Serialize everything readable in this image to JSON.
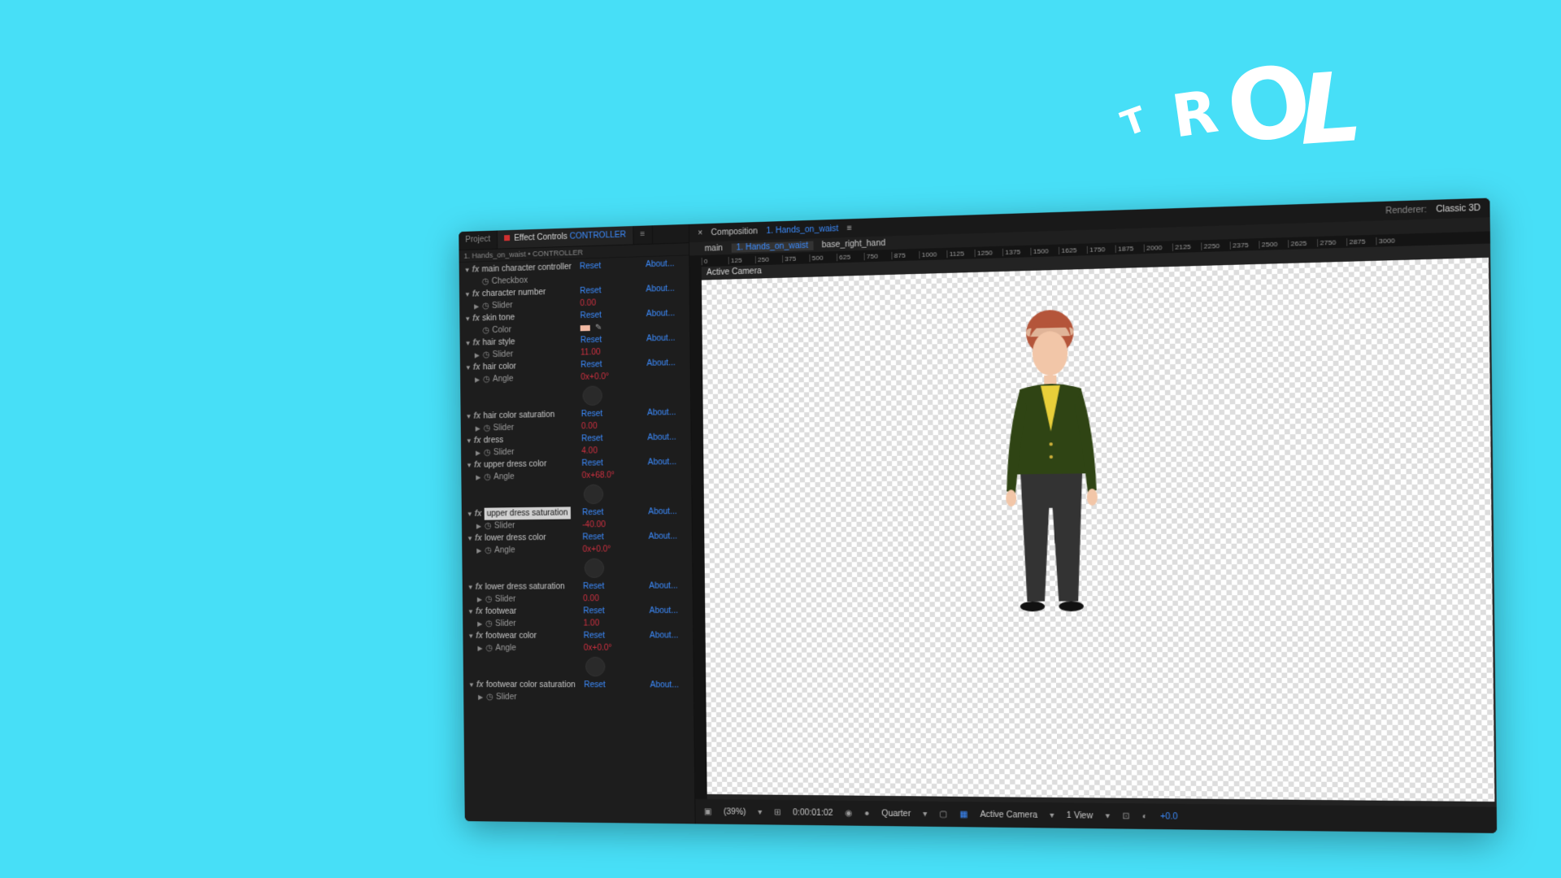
{
  "overlay_title": {
    "letters": [
      "T",
      "R",
      "O",
      "L"
    ]
  },
  "left_panel": {
    "tabs": {
      "project": "Project",
      "effect_controls": "Effect Controls",
      "effect_target": "CONTROLLER"
    },
    "breadcrumb": "1. Hands_on_waist • CONTROLLER",
    "reset_label": "Reset",
    "about_label": "About...",
    "effects": [
      {
        "name": "main character controller",
        "sub": "Checkbox",
        "subtype": "checkbox"
      },
      {
        "name": "character number",
        "sub": "Slider",
        "value": "0.00"
      },
      {
        "name": "skin tone",
        "sub": "Color",
        "subtype": "color",
        "color": "#f2b9a2"
      },
      {
        "name": "hair style",
        "sub": "Slider",
        "value": "11.00"
      },
      {
        "name": "hair color",
        "sub": "Angle",
        "value": "0x+0.0°",
        "dial": true
      },
      {
        "name": "hair color saturation",
        "sub": "Slider",
        "value": "0.00"
      },
      {
        "name": "dress",
        "sub": "Slider",
        "value": "4.00"
      },
      {
        "name": "upper dress color",
        "sub": "Angle",
        "value": "0x+68.0°",
        "dial": true
      },
      {
        "name": "upper dress saturation",
        "sub": "Slider",
        "value": "-40.00",
        "selected": true
      },
      {
        "name": "lower dress color",
        "sub": "Angle",
        "value": "0x+0.0°",
        "dial": true
      },
      {
        "name": "lower dress saturation",
        "sub": "Slider",
        "value": "0.00"
      },
      {
        "name": "footwear",
        "sub": "Slider",
        "value": "1.00"
      },
      {
        "name": "footwear color",
        "sub": "Angle",
        "value": "0x+0.0°",
        "dial": true
      },
      {
        "name": "footwear color saturation",
        "sub": "Slider",
        "value": ""
      }
    ]
  },
  "composition": {
    "label": "Composition",
    "name": "1. Hands_on_waist",
    "renderer_label": "Renderer:",
    "renderer_value": "Classic 3D",
    "crumbs": [
      "main",
      "1. Hands_on_waist",
      "base_right_hand"
    ],
    "ruler_ticks": [
      "0",
      "125",
      "250",
      "375",
      "500",
      "625",
      "750",
      "875",
      "1000",
      "1125",
      "1250",
      "1375",
      "1500",
      "1625",
      "1750",
      "1875",
      "2000",
      "2125",
      "2250",
      "2375",
      "2500",
      "2625",
      "2750",
      "2875",
      "3000"
    ],
    "view_label": "Active Camera"
  },
  "bottom_bar": {
    "zoom": "(39%)",
    "timecode": "0:00:01:02",
    "resolution": "Quarter",
    "camera": "Active Camera",
    "views": "1 View",
    "exposure": "+0.0"
  },
  "colors": {
    "background": "#47dff7",
    "accent": "#3c8cff",
    "value_red": "#d03040"
  }
}
